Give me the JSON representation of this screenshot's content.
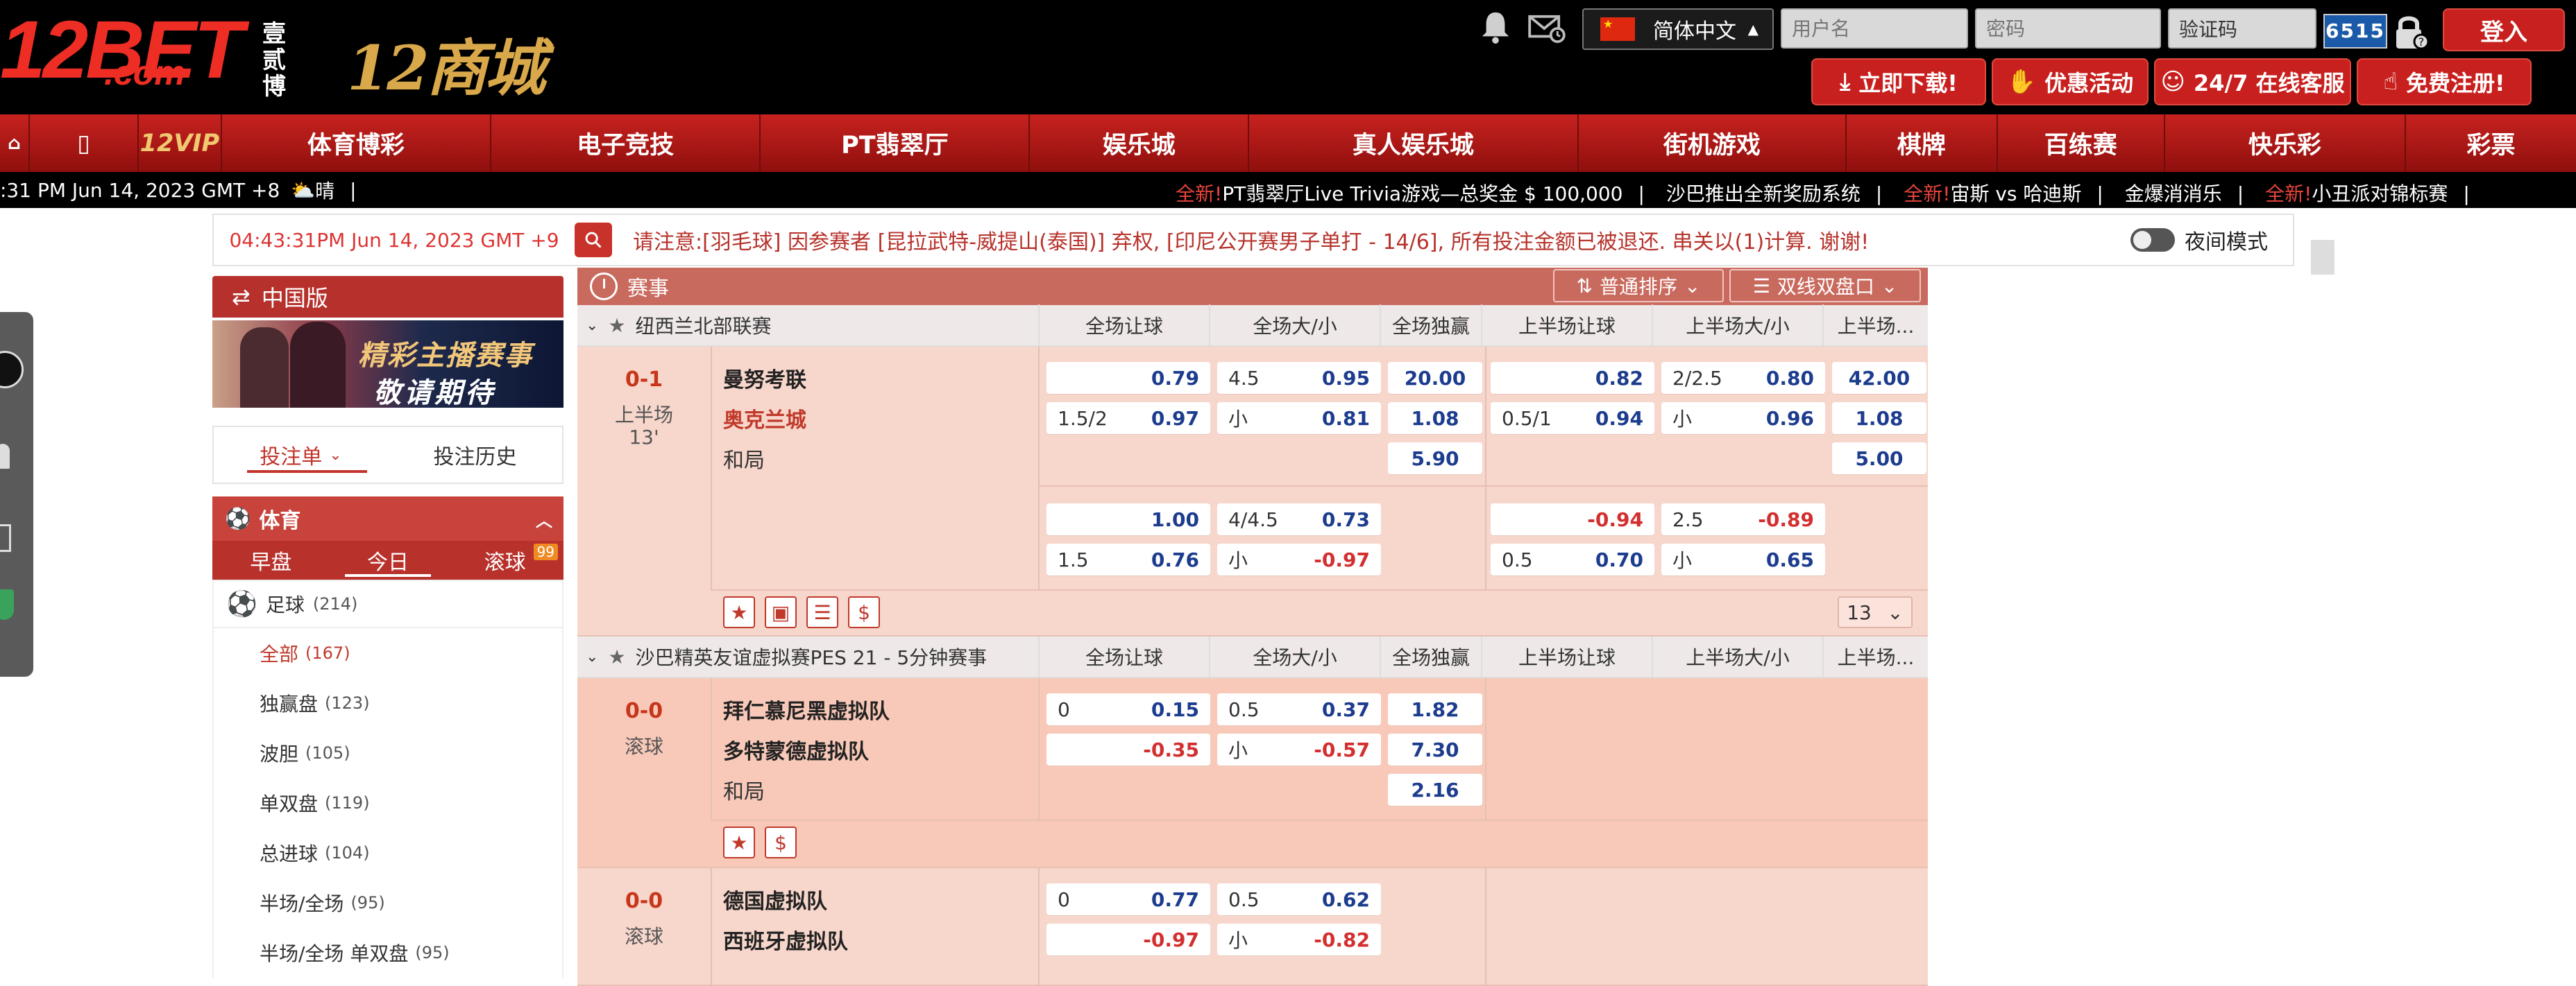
{
  "header": {
    "logo_text": "12BET",
    "logo_com": ".com",
    "logo_cn": "壹贰博",
    "shop_logo": "12商城",
    "language": "简体中文",
    "username_placeholder": "用户名",
    "password_placeholder": "密码",
    "captcha_value": "验证码",
    "captcha_code": "6515",
    "login_label": "登入",
    "download_label": "立即下载!",
    "promo_label": "优惠活动",
    "service_label": "24/7 在线客服",
    "register_label": "免费注册!"
  },
  "nav": {
    "items": [
      {
        "label": "",
        "icon": "home-icon"
      },
      {
        "label": "",
        "icon": "mobile-icon"
      },
      {
        "label": "12VIP"
      },
      {
        "label": "体育博彩"
      },
      {
        "label": "电子竞技"
      },
      {
        "label": "PT翡翠厅"
      },
      {
        "label": "娱乐城"
      },
      {
        "label": "真人娱乐城"
      },
      {
        "label": "街机游戏"
      },
      {
        "label": "棋牌"
      },
      {
        "label": "百练赛"
      },
      {
        "label": "快乐彩"
      },
      {
        "label": "彩票"
      }
    ]
  },
  "ticker": {
    "time": ":31 PM Jun 14, 2023 GMT +8",
    "weather": "晴",
    "messages": [
      {
        "new": "全新!",
        "text": "PT翡翠厅Live Trivia游戏—总奖金 $ 100,000"
      },
      {
        "new": "",
        "text": "沙巴推出全新奖励系统"
      },
      {
        "new": "全新!",
        "text": "宙斯 vs 哈迪斯"
      },
      {
        "new": "",
        "text": "金爆消消乐"
      },
      {
        "new": "全新!",
        "text": "小丑派对锦标赛"
      }
    ]
  },
  "notice": {
    "time": "04:43:31PM Jun 14, 2023 GMT +9",
    "text": "请注意:[羽毛球] 因参赛者 [昆拉武特-威提山(泰国)] 弃权, [印尼公开赛男子单打 - 14/6], 所有投注金额已被退还. 串关以(1)计算. 谢谢!",
    "night_mode": "夜间模式"
  },
  "sidebar": {
    "china_version": "中国版",
    "banner_line1": "精彩主播赛事",
    "banner_line2": "敬请期待",
    "betslip_tab": "投注单",
    "history_tab": "投注历史",
    "sport_title": "体育",
    "tabs": [
      "早盘",
      "今日",
      "滚球"
    ],
    "live_badge": "99",
    "soccer_label": "足球",
    "soccer_count": "(214)",
    "sub_items": [
      {
        "label": "全部",
        "count": "(167)"
      },
      {
        "label": "独赢盘",
        "count": "(123)"
      },
      {
        "label": "波胆",
        "count": "(105)"
      },
      {
        "label": "单双盘",
        "count": "(119)"
      },
      {
        "label": "总进球",
        "count": "(104)"
      },
      {
        "label": "半场/全场",
        "count": "(95)"
      },
      {
        "label": "半场/全场 单双盘",
        "count": "(95)"
      }
    ]
  },
  "main": {
    "title": "赛事",
    "sort_label": "普通排序",
    "view_label": "双线双盘口",
    "columns": [
      "全场让球",
      "全场大/小",
      "全场独赢",
      "上半场让球",
      "上半场大/小",
      "上半场..."
    ],
    "league1": "纽西兰北部联赛",
    "match1": {
      "score": "0-1",
      "period": "上半场",
      "minute": "13'",
      "home": "曼努考联",
      "away": "奥克兰城",
      "draw": "和局",
      "more": "13",
      "row1": {
        "hdp_k": "",
        "hdp": "0.79",
        "ou_k": "4.5",
        "ou": "0.95",
        "x12": "20.00",
        "h1_k": "",
        "h1": "0.82",
        "h1ou_k": "2/2.5",
        "h1ou": "0.80",
        "h1x": "42.00"
      },
      "row2": {
        "hdp_k": "1.5/2",
        "hdp": "0.97",
        "ou_k": "小",
        "ou": "0.81",
        "x12": "1.08",
        "h1_k": "0.5/1",
        "h1": "0.94",
        "h1ou_k": "小",
        "h1ou": "0.96",
        "h1x": "1.08"
      },
      "row3": {
        "x12": "5.90",
        "h1x": "5.00"
      },
      "row4": {
        "hdp": "1.00",
        "ou_k": "4/4.5",
        "ou": "0.73",
        "h1": "-0.94",
        "h1ou_k": "2.5",
        "h1ou": "-0.89"
      },
      "row5": {
        "hdp_k": "1.5",
        "hdp": "0.76",
        "ou_k": "小",
        "ou": "-0.97",
        "h1_k": "0.5",
        "h1": "0.70",
        "h1ou_k": "小",
        "h1ou": "0.65"
      }
    },
    "league2": "沙巴精英友谊虚拟赛PES 21 - 5分钟赛事",
    "match2": {
      "score": "0-0",
      "period": "滚球",
      "home": "拜仁慕尼黑虚拟队",
      "away": "多特蒙德虚拟队",
      "draw": "和局",
      "row1": {
        "hdp_k": "0",
        "hdp": "0.15",
        "ou_k": "0.5",
        "ou": "0.37",
        "x12": "1.82"
      },
      "row2": {
        "hdp": "-0.35",
        "ou_k": "小",
        "ou": "-0.57",
        "x12": "7.30"
      },
      "row3": {
        "x12": "2.16"
      }
    },
    "match3": {
      "score": "0-0",
      "period": "滚球",
      "home": "德国虚拟队",
      "away": "西班牙虚拟队",
      "row1": {
        "hdp_k": "0",
        "hdp": "0.77",
        "ou_k": "0.5",
        "ou": "0.62"
      },
      "row2": {
        "hdp": "-0.97",
        "ou_k": "小",
        "ou": "-0.82"
      }
    }
  }
}
